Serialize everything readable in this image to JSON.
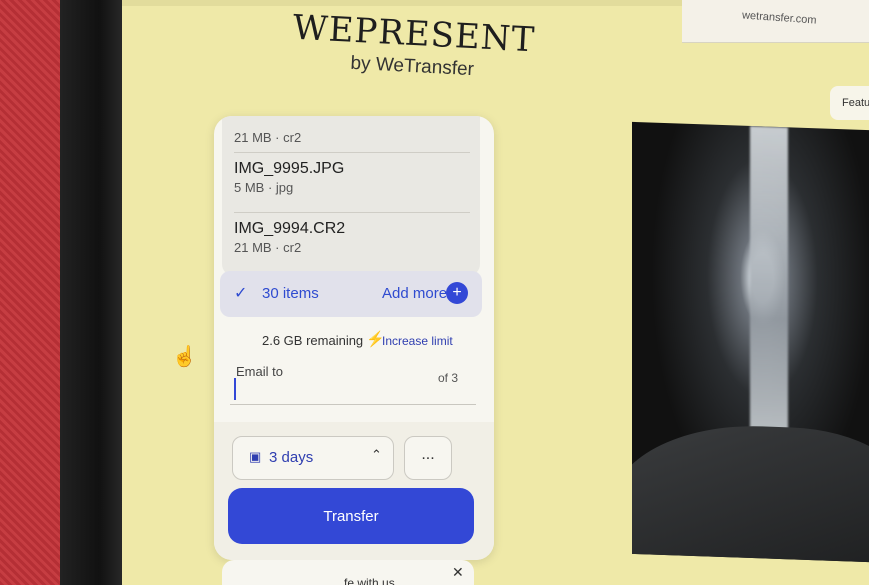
{
  "browser": {
    "url": "wetransfer.com"
  },
  "brand": {
    "title": "WEPRESENT",
    "subtitle": "by WeTransfer"
  },
  "header": {
    "features_label": "Feature"
  },
  "files": [
    {
      "name": "",
      "meta": "21 MB · cr2"
    },
    {
      "name": "IMG_9995.JPG",
      "meta": "5 MB · jpg"
    },
    {
      "name": "IMG_9994.CR2",
      "meta": "21 MB · cr2"
    }
  ],
  "transfer": {
    "items_count": "30 items",
    "add_more": "Add more",
    "remaining": "2.6 GB remaining",
    "increase_limit": "Increase limit",
    "email_label": "Email to",
    "email_value": "",
    "email_count": "of 3",
    "expiry": "3 days",
    "more_label": "...",
    "transfer_label": "Transfer"
  },
  "toast": {
    "text": "fe with us"
  },
  "icons": {
    "check": "check-icon",
    "plus": "plus-icon",
    "bolt": "bolt-icon",
    "calendar": "calendar-icon",
    "chevron": "chevron-up-icon",
    "close": "close-icon",
    "cursor": "hand-pointer-icon"
  },
  "colors": {
    "accent": "#3348d6",
    "page_background": "#efe9a8"
  }
}
